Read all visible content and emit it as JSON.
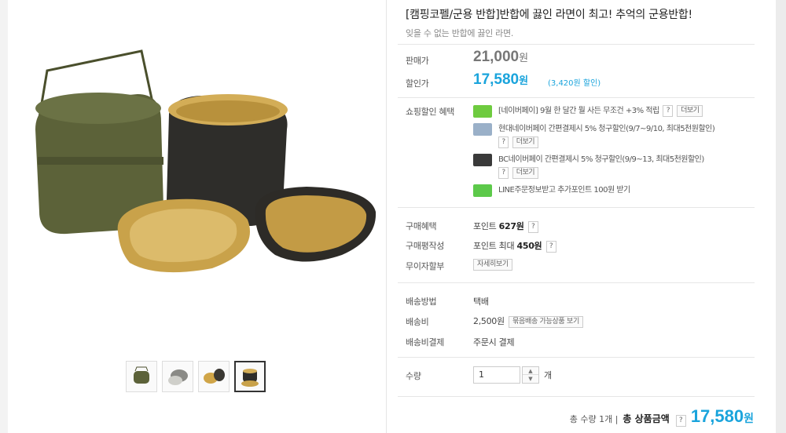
{
  "product": {
    "title": "[캠핑코펠/군용 반합]반합에 끓인 라면이 최고! 추억의 군용반합!",
    "subtitle": "잊을 수 없는 반합에 끓인 라면."
  },
  "price": {
    "original_label": "판매가",
    "original_value": "21,000",
    "original_unit": "원",
    "sale_label": "할인가",
    "sale_value": "17,580",
    "sale_unit": "원",
    "discount": "(3,420원 할인)"
  },
  "benefits": {
    "label": "쇼핑할인 혜택",
    "items": [
      {
        "text": "[네이버페이] 9월 한 달간 뭘 사든 무조건 +3% 적립",
        "more": "더보기",
        "icon_color": "#6ecb3f"
      },
      {
        "text": "현대네이버페이 간편결제시 5% 청구할인(9/7~9/10, 최대5천원할인)",
        "more": "더보기",
        "icon_color": "#9ab0c8"
      },
      {
        "text": "BC네이버페이 간편결제시 5% 청구할인(9/9~13, 최대5천원할인)",
        "more": "더보기",
        "icon_color": "#3a3a3a"
      },
      {
        "text": "LINE주문정보받고 추가포인트 100원 받기",
        "icon_color": "#5cc94a"
      }
    ],
    "question": "?"
  },
  "purchase": {
    "benefit_label": "구매혜택",
    "benefit_text": "포인트",
    "benefit_value": "627원",
    "review_label": "구매평작성",
    "review_text": "포인트 최대",
    "review_value": "450원",
    "installment_label": "무이자할부",
    "installment_button": "자세히보기"
  },
  "shipping": {
    "method_label": "배송방법",
    "method_value": "택배",
    "fee_label": "배송비",
    "fee_value": "2,500원",
    "fee_button": "묶음배송 가능상품 보기",
    "payment_label": "배송비결제",
    "payment_value": "주문시 결제"
  },
  "quantity": {
    "label": "수량",
    "value": "1",
    "unit": "개",
    "up": "▲",
    "down": "▼"
  },
  "total": {
    "count": "총 수량 1개 |",
    "label": "총 상품금액",
    "question": "?",
    "value": "17,580",
    "unit": "원"
  },
  "colors": {
    "accent": "#1aa4dc",
    "olive": "#565c37",
    "brass": "#c9a24a"
  },
  "thumbnails": [
    "mess-kit-olive",
    "mess-kit-steel",
    "mess-kit-brass",
    "mess-kit-black"
  ]
}
